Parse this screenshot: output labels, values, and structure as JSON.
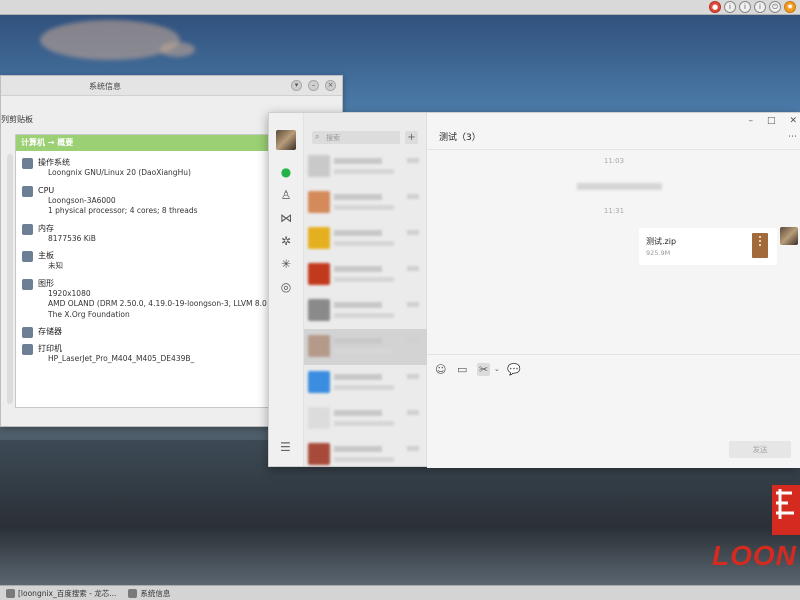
{
  "top_panel": {
    "tray_icons": [
      "app-icon-red",
      "info-icon",
      "info-icon",
      "info-icon",
      "power-icon",
      "orange-app-icon"
    ]
  },
  "sysinfo": {
    "title": "系统信息",
    "toolbar_label": "列剪贴板",
    "header": "计算机 → 概要",
    "sections": [
      {
        "icon": "gear-icon",
        "title": "操作系统",
        "lines": [
          "Loongnix GNU/Linux 20 (DaoXiangHu)"
        ]
      },
      {
        "icon": "cpu-icon",
        "title": "CPU",
        "lines": [
          "Loongson-3A6000",
          "1 physical processor; 4 cores; 8 threads"
        ]
      },
      {
        "icon": "memory-icon",
        "title": "内存",
        "lines": [
          "8177536 KiB"
        ]
      },
      {
        "icon": "gear-icon",
        "title": "主板",
        "lines": [
          "未知"
        ]
      },
      {
        "icon": "monitor-icon",
        "title": "图形",
        "lines": [
          "1920x1080",
          "AMD OLAND (DRM 2.50.0, 4.19.0-19-loongson-3, LLVM 8.0",
          "The X.Org Foundation"
        ]
      },
      {
        "icon": "storage-icon",
        "title": "存储器",
        "lines": []
      },
      {
        "icon": "printer-icon",
        "title": "打印机",
        "lines": [
          "HP_LaserJet_Pro_M404_M405_DE439B_"
        ]
      }
    ]
  },
  "chat": {
    "search_placeholder": "搜索",
    "add_label": "+",
    "title": "测试（3）",
    "time_1": "11:03",
    "time_2": "11:31",
    "file": {
      "name": "测试.zip",
      "size": "925.9M"
    },
    "send_label": "发送",
    "win_min": "–",
    "win_max": "□",
    "win_close": "✕",
    "more": "⋯",
    "conversations": [
      {
        "color": "#c9c9c9"
      },
      {
        "color": "#d48a5a"
      },
      {
        "color": "#e5b020"
      },
      {
        "color": "#c23a1e"
      },
      {
        "color": "#8a8a8a"
      },
      {
        "color": "#b59a8a"
      },
      {
        "color": "#3a8de0"
      },
      {
        "color": "#dcdcdc"
      },
      {
        "color": "#a84a3a"
      }
    ]
  },
  "taskbar": {
    "items": [
      "[loongnix_百度搜索 - 龙芯...",
      "系统信息"
    ]
  },
  "desktop": {
    "brand": "LOON",
    "brand_color": "#d42a1f"
  }
}
